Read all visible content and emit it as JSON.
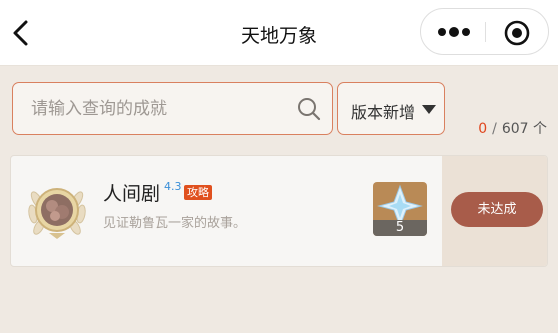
{
  "header": {
    "title": "天地万象",
    "back_icon": "chevron-left-icon",
    "more_icon": "more-dots-icon",
    "close_icon": "target-close-icon"
  },
  "search": {
    "placeholder": "请输入查询的成就",
    "value": "",
    "icon": "search-icon"
  },
  "filter": {
    "label": "版本新增",
    "icon": "chevron-down-icon"
  },
  "counter": {
    "achieved": "0",
    "separator": "/",
    "total": "607 个"
  },
  "achievements": [
    {
      "title": "人间剧",
      "version": "4.3",
      "tag": "攻略",
      "description": "见证勒鲁瓦一家的故事。",
      "reward_icon": "primogem-icon",
      "reward_count": "5",
      "status": "未达成"
    }
  ],
  "colors": {
    "background": "#efe9e2",
    "accent_border": "#d9805f",
    "counter_highlight": "#e0461e",
    "version_blue": "#3a8fd8",
    "tag_orange": "#e0501e",
    "status_button": "#a85c4a"
  }
}
